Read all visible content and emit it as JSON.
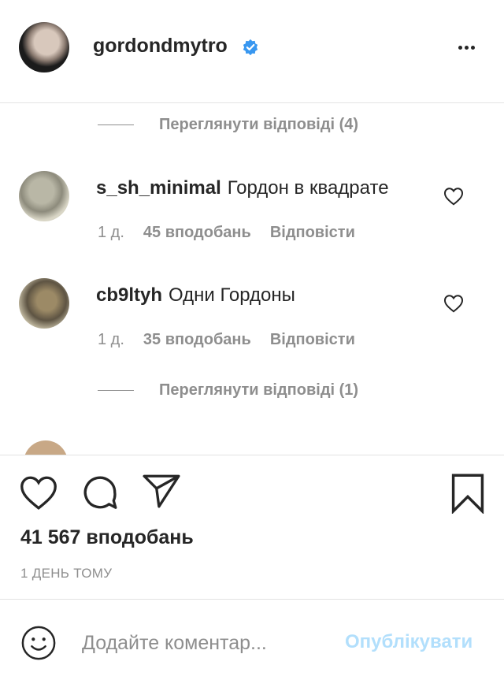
{
  "post_header": {
    "username": "gordondmytro",
    "verified_icon": "verified-badge-icon",
    "more_icon": "more-options-icon",
    "accent": "#3897f0"
  },
  "comments": {
    "view_replies_1": "Переглянути відповіді (4)",
    "items": [
      {
        "username": "s_sh_minimal",
        "text": "Гордон в квадрате",
        "age": "1 д.",
        "likes": "45 вподобань",
        "reply": "Відповісти"
      },
      {
        "username": "cb9ltyh",
        "text": "Одни Гордоны",
        "age": "1 д.",
        "likes": "35 вподобань",
        "reply": "Відповісти"
      }
    ],
    "view_replies_2": "Переглянути відповіді (1)"
  },
  "actions": {
    "like_icon": "heart-icon",
    "comment_icon": "comment-icon",
    "share_icon": "paper-plane-icon",
    "save_icon": "bookmark-icon",
    "likes_count": "41 567 вподобань",
    "timestamp": "1 ДЕНЬ ТОМУ"
  },
  "composer": {
    "emoji_icon": "smiley-icon",
    "placeholder": "Додайте коментар...",
    "post_label": "Опублікувати",
    "post_color": "#b2dffc"
  }
}
